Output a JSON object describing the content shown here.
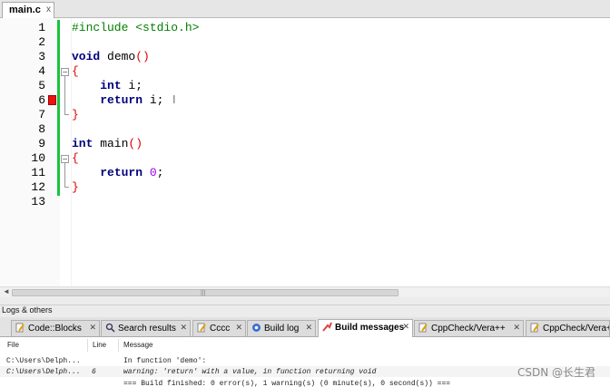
{
  "editor_tab": {
    "label": "main.c",
    "close": "x"
  },
  "line_numbers": [
    "1",
    "2",
    "3",
    "4",
    "5",
    "6",
    "7",
    "8",
    "9",
    "10",
    "11",
    "12",
    "13"
  ],
  "code": {
    "line1": {
      "pp": "#include <stdio.h>"
    },
    "line3": {
      "type": "void",
      "rest": " demo",
      "paren": "()"
    },
    "line4": {
      "brace": "{"
    },
    "line5": {
      "indent": "    ",
      "type": "int",
      "rest": " i;"
    },
    "line6": {
      "indent": "    ",
      "kw": "return",
      "rest": " i;"
    },
    "line7": {
      "brace": "}"
    },
    "line9": {
      "type": "int",
      "rest": " main",
      "paren": "()"
    },
    "line10": {
      "brace": "{"
    },
    "line11": {
      "indent": "    ",
      "kw": "return",
      "sp": " ",
      "num": "0",
      "semi": ";"
    },
    "line12": {
      "brace": "}"
    }
  },
  "colors": {
    "keyword": "#00007f",
    "preprocessor": "#007f00",
    "number": "#9900ee",
    "brace_match": "#e00000",
    "change_bar": "#19c43a",
    "error_marker": "#e11111"
  },
  "logs": {
    "title": "Logs & others",
    "tabs": [
      {
        "label": "Code::Blocks",
        "icon": "doc-pencil-icon"
      },
      {
        "label": "Search results",
        "icon": "search-icon"
      },
      {
        "label": "Cccc",
        "icon": "doc-pencil-icon"
      },
      {
        "label": "Build log",
        "icon": "gear-icon"
      },
      {
        "label": "Build messages",
        "icon": "build-messages-icon",
        "active": true
      },
      {
        "label": "CppCheck/Vera++",
        "icon": "doc-pencil-icon"
      },
      {
        "label": "CppCheck/Vera++",
        "icon": "doc-pencil-icon"
      }
    ],
    "columns": {
      "file": "File",
      "line": "Line",
      "message": "Message"
    },
    "rows": [
      {
        "file": "C:\\Users\\Delph...",
        "line": "",
        "message": "In function 'demo':"
      },
      {
        "file": "C:\\Users\\Delph...",
        "line": "6",
        "message": "warning: 'return' with a value, in function returning void"
      },
      {
        "file": "",
        "line": "",
        "message": "=== Build finished: 0 error(s), 1 warning(s) (0 minute(s), 0 second(s)) ==="
      }
    ]
  },
  "watermark": "CSDN @长生君"
}
